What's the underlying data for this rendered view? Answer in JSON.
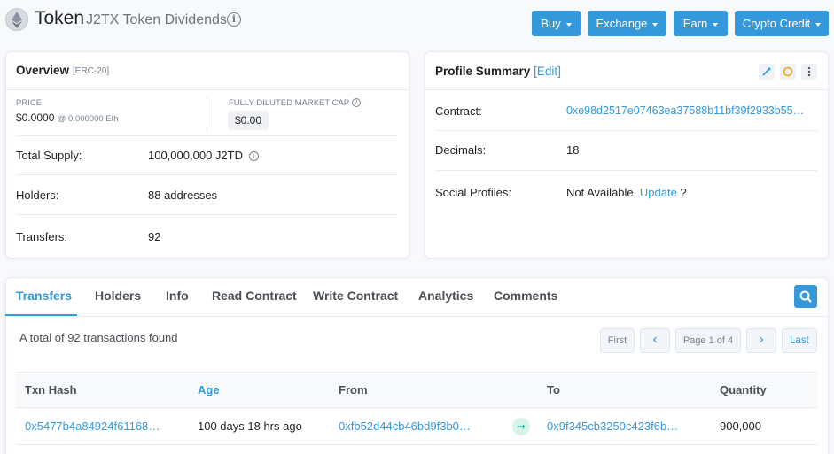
{
  "header": {
    "title": "Token",
    "subtitle": "J2TX Token Dividends",
    "buttons": [
      {
        "label": "Buy"
      },
      {
        "label": "Exchange"
      },
      {
        "label": "Earn"
      },
      {
        "label": "Crypto Credit"
      }
    ]
  },
  "overview": {
    "title": "Overview",
    "standard": "[ERC-20]",
    "price_label": "PRICE",
    "price_value": "$0.0000",
    "price_eth": "@ 0.000000 Eth",
    "market_cap_label": "FULLY DILUTED MARKET CAP",
    "market_cap_value": "$0.00",
    "total_supply_label": "Total Supply:",
    "total_supply_value": "100,000,000 J2TD",
    "holders_label": "Holders:",
    "holders_value": "88 addresses",
    "transfers_label": "Transfers:",
    "transfers_value": "92"
  },
  "profile": {
    "title": "Profile Summary",
    "edit": "[Edit]",
    "contract_label": "Contract:",
    "contract_value": "0xe98d2517e07463ea37588b11bf39f2933b55…",
    "decimals_label": "Decimals:",
    "decimals_value": "18",
    "social_label": "Social Profiles:",
    "social_value": "Not Available,",
    "social_link": "Update",
    "social_q": "?"
  },
  "tabs": [
    {
      "label": "Transfers"
    },
    {
      "label": "Holders"
    },
    {
      "label": "Info"
    },
    {
      "label": "Read Contract"
    },
    {
      "label": "Write Contract"
    },
    {
      "label": "Analytics"
    },
    {
      "label": "Comments"
    }
  ],
  "transfers": {
    "summary": "A total of 92 transactions found",
    "pagination": {
      "first": "First",
      "prev": "‹",
      "page": "Page 1 of 4",
      "next": "›",
      "last": "Last"
    },
    "columns": {
      "hash": "Txn Hash",
      "age": "Age",
      "from": "From",
      "to": "To",
      "quantity": "Quantity"
    },
    "rows": [
      {
        "hash": "0x5477b4a84924f61168…",
        "age": "100 days 18 hrs ago",
        "from": "0xfb52d44cb46bd9f3b0…",
        "to": "0x9f345cb3250c423f6b…",
        "quantity": "900,000"
      }
    ]
  },
  "colors": {
    "accent": "#3498db",
    "success": "#00a186"
  }
}
